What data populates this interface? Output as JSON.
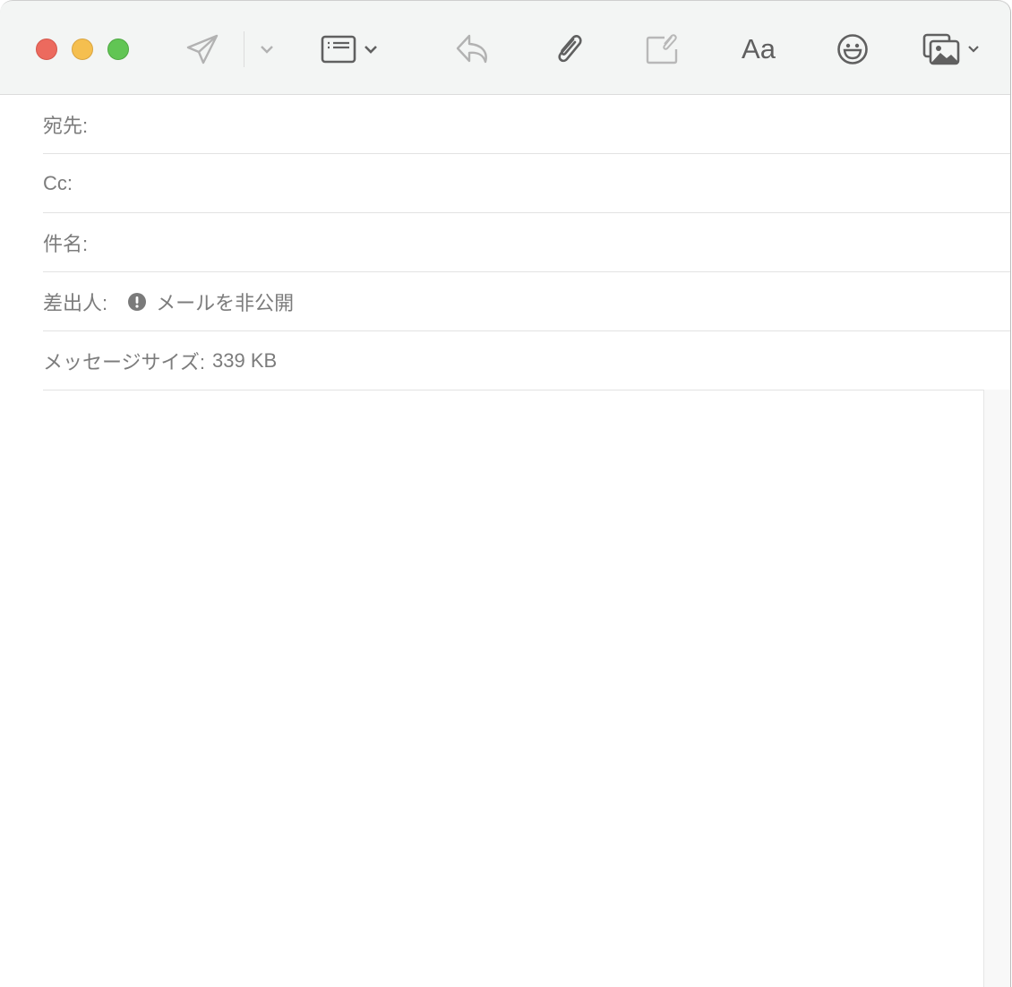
{
  "window": {
    "traffic_lights": [
      {
        "name": "close",
        "color": "#ec6a5e"
      },
      {
        "name": "minimize",
        "color": "#f5bf4f"
      },
      {
        "name": "zoom",
        "color": "#61c554"
      }
    ]
  },
  "toolbar": {
    "icons": [
      "send-icon",
      "chevron-down-icon",
      "header-fields-icon",
      "reply-icon",
      "attachment-icon",
      "attach-in-place-icon",
      "format-icon",
      "emoji-icon",
      "photo-browser-icon"
    ],
    "format_label": "Aa"
  },
  "header": {
    "to_label": "宛先:",
    "cc_label": "Cc:",
    "subject_label": "件名:",
    "from_label": "差出人:",
    "from_value": "メールを非公開",
    "size_label": "メッセージサイズ:",
    "size_value": "339 KB"
  }
}
